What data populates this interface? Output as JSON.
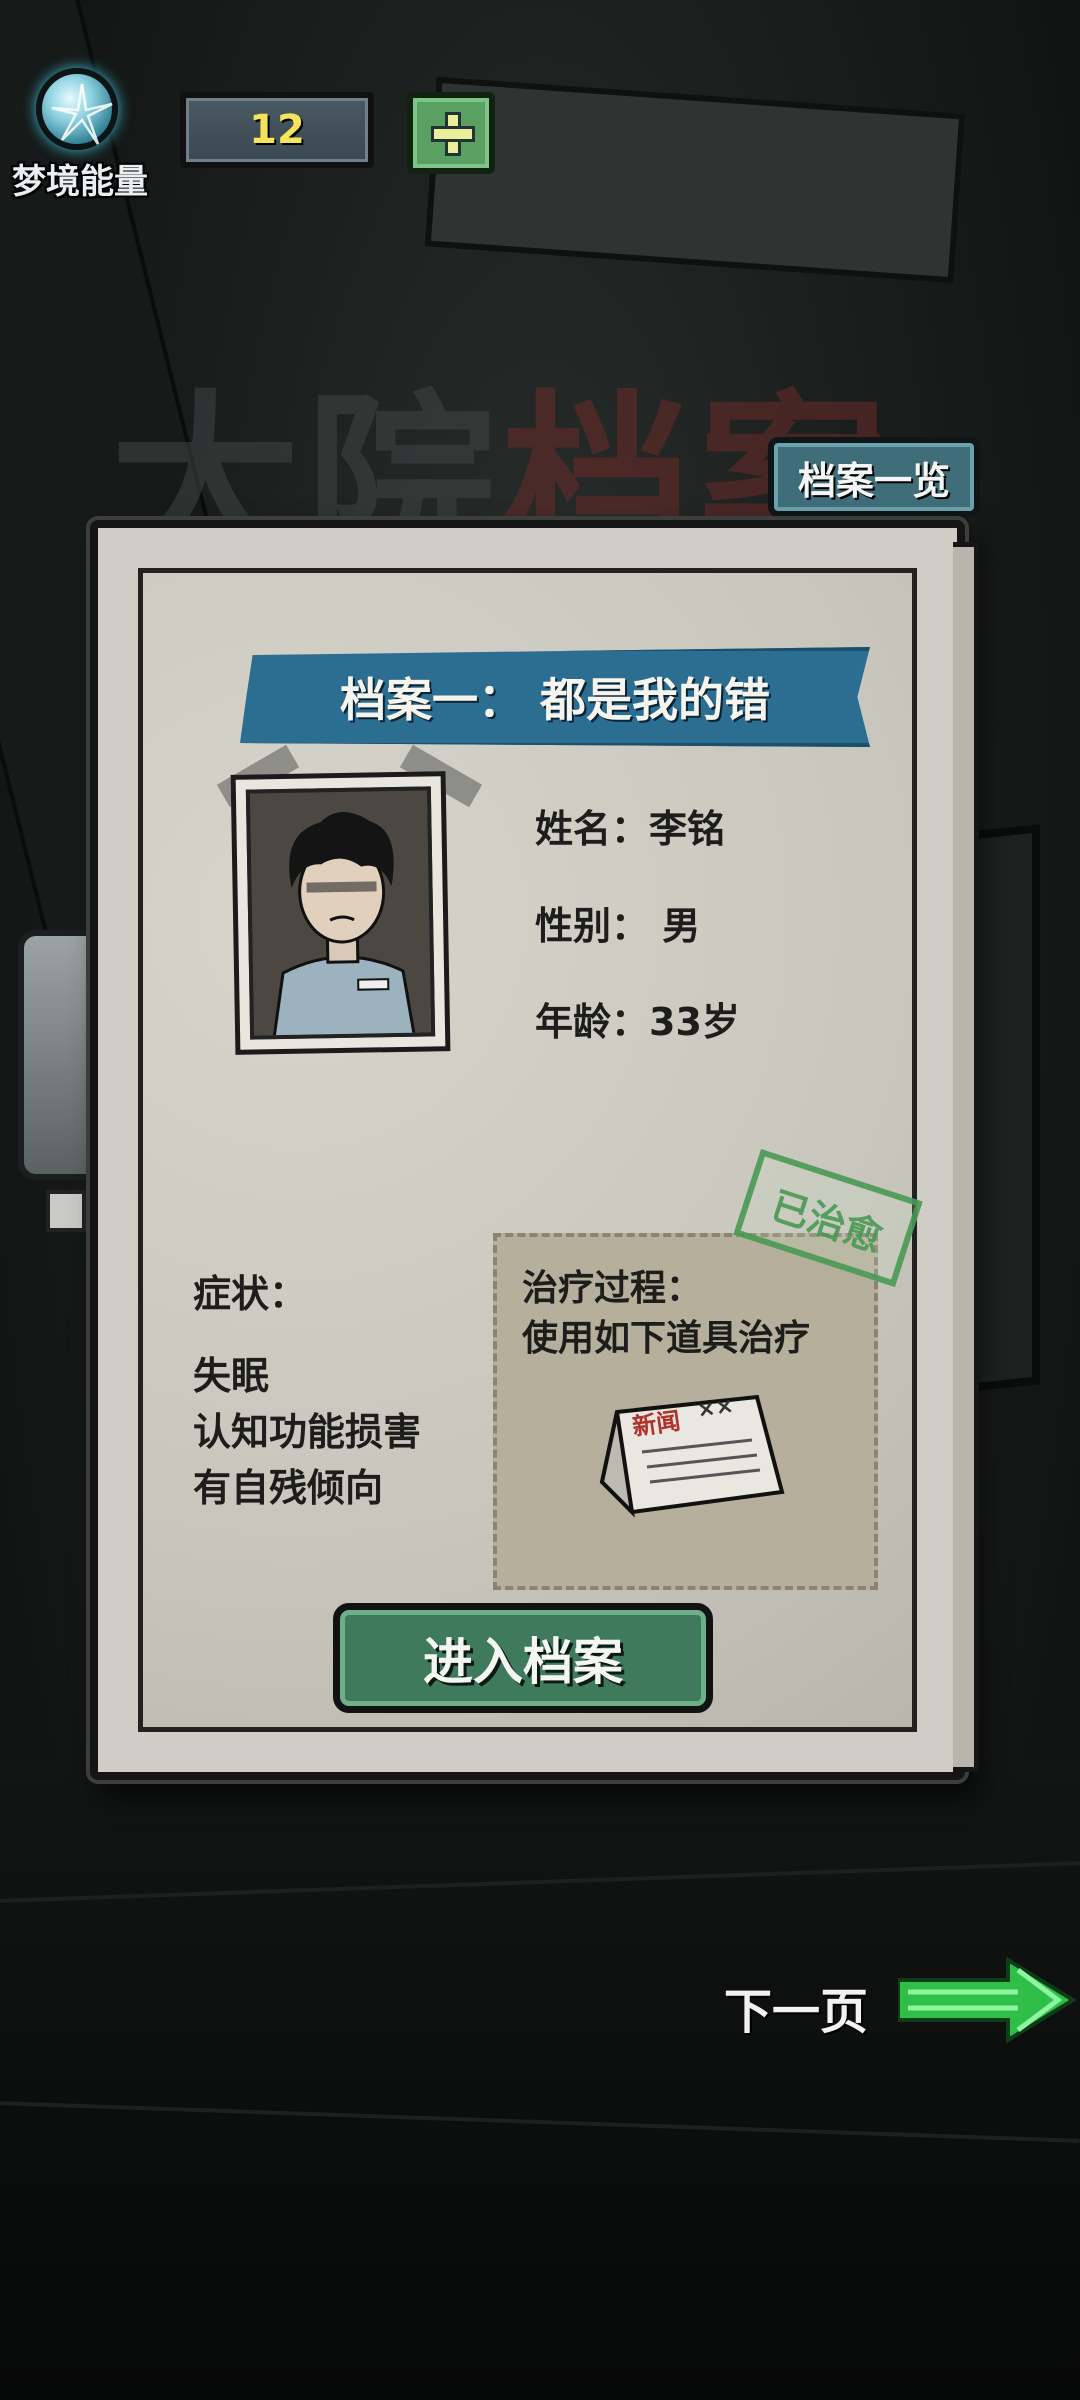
{
  "hud": {
    "energy_label": "梦境能量",
    "energy_count": "12",
    "add_icon": "plus-icon",
    "energy_icon": "dream-orb-icon"
  },
  "background": {
    "title_part1": "大院",
    "title_part2": "档案"
  },
  "archive_list_button": "档案一览",
  "card": {
    "title": "档案一：  都是我的错",
    "name": "姓名：李铭",
    "gender": "性别：  男",
    "age": "年龄：33岁",
    "stamp": "已治愈",
    "symptoms_title": "症状：",
    "symptoms": [
      "失眠",
      "认知功能损害",
      "有自残倾向"
    ],
    "treatment_title": "治疗过程：",
    "treatment_desc": "使用如下道具治疗",
    "item_label": "新闻",
    "item_marks": "××",
    "enter_button": "进入档案"
  },
  "next_page": "下一页",
  "colors": {
    "ribbon": "#2c6d92",
    "enter_button": "#3f7a5c",
    "stamp": "#4a9a55",
    "counter_text": "#f4e45a",
    "next_arrow": "#3ee05a"
  }
}
